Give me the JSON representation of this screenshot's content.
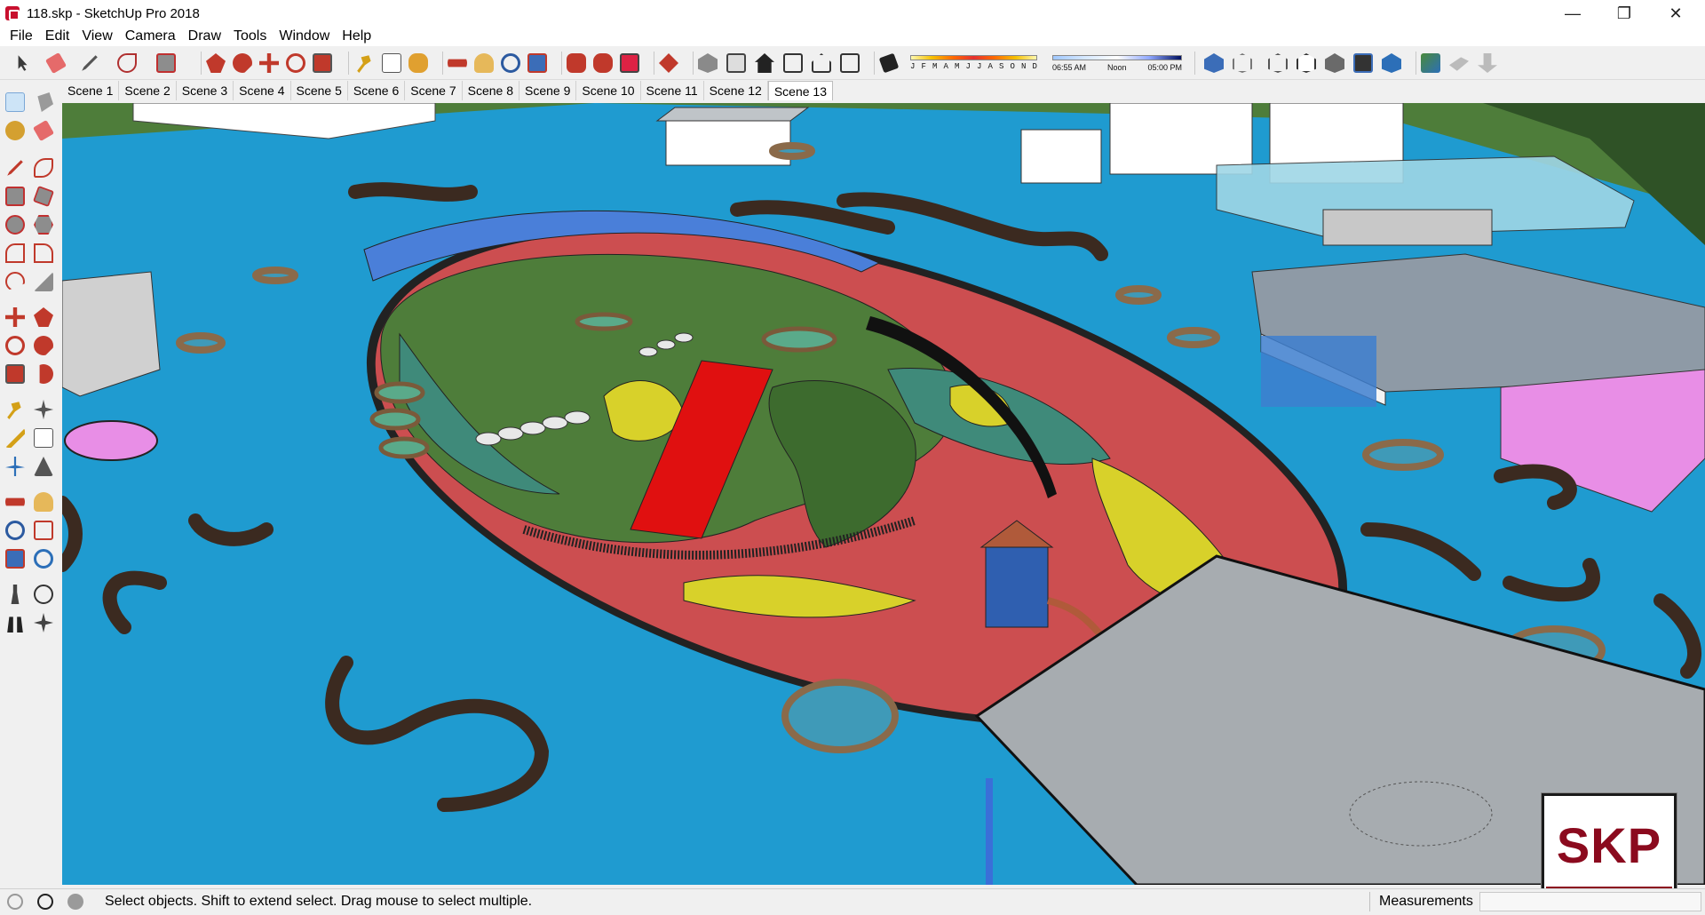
{
  "window": {
    "title": "118.skp - SketchUp Pro 2018",
    "minimize": "—",
    "maximize": "❐",
    "close": "✕"
  },
  "menu": [
    "File",
    "Edit",
    "View",
    "Camera",
    "Draw",
    "Tools",
    "Window",
    "Help"
  ],
  "toolbar": {
    "months": [
      "J",
      "F",
      "M",
      "A",
      "M",
      "J",
      "J",
      "A",
      "S",
      "O",
      "N",
      "D"
    ],
    "time_labels": [
      "06:55 AM",
      "Noon",
      "05:00 PM"
    ]
  },
  "scenes": {
    "tabs": [
      "Scene 1",
      "Scene 2",
      "Scene 3",
      "Scene 4",
      "Scene 5",
      "Scene 6",
      "Scene 7",
      "Scene 8",
      "Scene 9",
      "Scene 10",
      "Scene 11",
      "Scene 12",
      "Scene 13"
    ],
    "active": "Scene 13"
  },
  "logo": {
    "text": "SKP"
  },
  "status": {
    "message": "Select objects. Shift to extend select. Drag mouse to select multiple.",
    "measurements_label": "Measurements",
    "measurements_value": ""
  },
  "colors": {
    "water": "#1f9bd0",
    "lawn": "#4e7d3a",
    "rubber_red": "#c44a4a",
    "rubber_yellow": "#d8d12a",
    "rubber_teal": "#3f8a7a",
    "logo_red": "#8b0a1e"
  }
}
